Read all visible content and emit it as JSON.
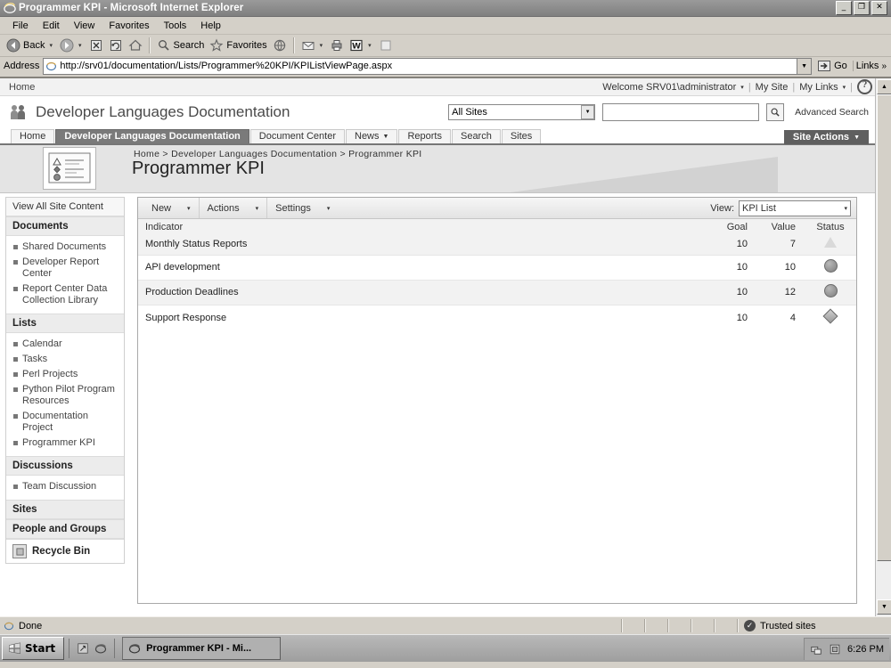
{
  "window": {
    "title": "Programmer KPI - Microsoft Internet Explorer",
    "minimize": "_",
    "restore": "❐",
    "close": "✕"
  },
  "menubar": [
    {
      "label": "File"
    },
    {
      "label": "Edit"
    },
    {
      "label": "View"
    },
    {
      "label": "Favorites"
    },
    {
      "label": "Tools"
    },
    {
      "label": "Help"
    }
  ],
  "toolbar": {
    "back": "Back",
    "search": "Search",
    "favorites": "Favorites",
    "arrow": "▾"
  },
  "address": {
    "label": "Address",
    "url": "http://srv01/documentation/Lists/Programmer%20KPI/KPIListViewPage.aspx",
    "go": "Go",
    "links": "Links",
    "chevrons": "»"
  },
  "globalbar": {
    "home": "Home",
    "welcome": "Welcome SRV01\\administrator",
    "my_site": "My Site",
    "my_links": "My Links",
    "caret": "▾",
    "help": "?"
  },
  "site": {
    "title": "Developer Languages Documentation",
    "search_scope": "All Sites",
    "search_value": "",
    "search_placeholder": "",
    "advanced_search": "Advanced Search",
    "site_actions": "Site Actions",
    "tabs": [
      {
        "label": "Home",
        "active": false,
        "has_caret": false
      },
      {
        "label": "Developer Languages Documentation",
        "active": true,
        "has_caret": false
      },
      {
        "label": "Document Center",
        "active": false,
        "has_caret": false
      },
      {
        "label": "News",
        "active": false,
        "has_caret": true
      },
      {
        "label": "Reports",
        "active": false,
        "has_caret": false
      },
      {
        "label": "Search",
        "active": false,
        "has_caret": false
      },
      {
        "label": "Sites",
        "active": false,
        "has_caret": false
      }
    ]
  },
  "banner": {
    "breadcrumb": "Home > Developer Languages Documentation > Programmer KPI",
    "page_title": "Programmer KPI"
  },
  "sidebar": {
    "view_all": "View All Site Content",
    "groups": [
      {
        "heading": "Documents",
        "items": [
          {
            "label": "Shared Documents"
          },
          {
            "label": "Developer Report Center"
          },
          {
            "label": "Report Center Data Collection Library"
          }
        ]
      },
      {
        "heading": "Lists",
        "items": [
          {
            "label": "Calendar"
          },
          {
            "label": "Tasks"
          },
          {
            "label": "Perl Projects"
          },
          {
            "label": "Python Pilot Program Resources"
          },
          {
            "label": "Documentation Project"
          },
          {
            "label": "Programmer KPI"
          }
        ]
      },
      {
        "heading": "Discussions",
        "items": [
          {
            "label": "Team Discussion"
          }
        ]
      },
      {
        "heading": "Sites",
        "items": []
      },
      {
        "heading": "People and Groups",
        "items": []
      }
    ],
    "recycle_bin": "Recycle Bin"
  },
  "list_toolbar": {
    "buttons": [
      {
        "label": "New",
        "caret": "▾"
      },
      {
        "label": "Actions",
        "caret": "▾"
      },
      {
        "label": "Settings",
        "caret": "▾"
      }
    ],
    "view_label": "View:",
    "view_value": "KPI List",
    "caret": "▾"
  },
  "kpi_table": {
    "columns": [
      "Indicator",
      "Goal",
      "Value",
      "Status"
    ],
    "rows": [
      {
        "indicator": "Monthly Status Reports",
        "goal": "10",
        "value": "7",
        "status_icon": "warning-triangle-icon"
      },
      {
        "indicator": "API development",
        "goal": "10",
        "value": "10",
        "status_icon": "status-circle-icon"
      },
      {
        "indicator": "Production Deadlines",
        "goal": "10",
        "value": "12",
        "status_icon": "status-circle-icon"
      },
      {
        "indicator": "Support Response",
        "goal": "10",
        "value": "4",
        "status_icon": "status-diamond-icon"
      }
    ]
  },
  "statusbar": {
    "text": "Done",
    "zone": "Trusted sites",
    "zone_mark": "✓"
  },
  "taskbar": {
    "start": "Start",
    "task": "Programmer KPI - Mi...",
    "time": "6:26 PM"
  },
  "colors": {
    "window_chrome": "#d4d0c8",
    "tab_active_bg": "#7a7a7a",
    "site_actions_bg": "#5f5f5f",
    "banner_bg": "#e4e4e4",
    "row_alt_bg": "#f2f2f2"
  }
}
